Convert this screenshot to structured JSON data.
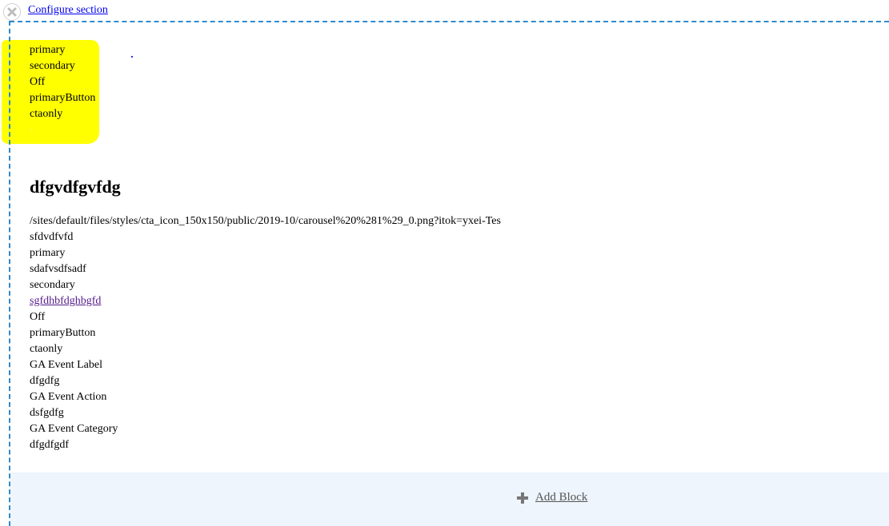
{
  "section": {
    "configure_link": "Configure section",
    "close_icon": "close-icon"
  },
  "highlighted_options": [
    "primary",
    "secondary",
    "Off",
    "primaryButton",
    "ctaonly",
    "-"
  ],
  "block": {
    "title": "dfgvdfgvfdg",
    "fields": [
      {
        "text": "/sites/default/files/styles/cta_icon_150x150/public/2019-10/carousel%20%281%29_0.png?itok=yxei-Tes",
        "link": false
      },
      {
        "text": "sfdvdfvfd",
        "link": false
      },
      {
        "text": "primary",
        "link": false
      },
      {
        "text": "sdafvsdfsadf",
        "link": false
      },
      {
        "text": "secondary",
        "link": false
      },
      {
        "text": "sgfdhbfdghbgfd",
        "link": true
      },
      {
        "text": "Off",
        "link": false
      },
      {
        "text": "primaryButton",
        "link": false
      },
      {
        "text": "ctaonly",
        "link": false
      },
      {
        "text": "GA Event Label",
        "link": false
      },
      {
        "text": "dfgdfg",
        "link": false
      },
      {
        "text": "GA Event Action",
        "link": false
      },
      {
        "text": "dsfgdfg",
        "link": false
      },
      {
        "text": "GA Event Category",
        "link": false
      },
      {
        "text": "dfgdfgdf",
        "link": false
      }
    ]
  },
  "add_block": {
    "label": "Add Block",
    "icon": "plus-icon"
  },
  "colors": {
    "section_border": "#2e8bd0",
    "highlight": "#ffff00",
    "add_block_bg": "#eef5fc",
    "link": "#0000ee",
    "visited_link": "#551a8b"
  }
}
